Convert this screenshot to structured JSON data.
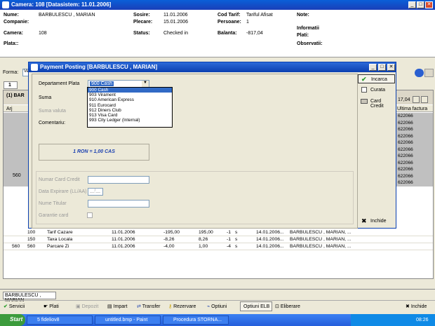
{
  "window": {
    "title": "Camera: 108  [Datasistem: 11.01.2006]",
    "btn_min": "_",
    "btn_max": "□",
    "btn_close": "✕"
  },
  "info": {
    "nume_label": "Nume:",
    "nume": "BARBULESCU , MARIAN",
    "companie_label": "Companie:",
    "camera_label": "Camera:",
    "camera": "108",
    "plata_label": "Plata::",
    "sosire_label": "Sosire:",
    "sosire": "11.01.2006",
    "plecare_label": "Plecare:",
    "plecare": "15.01.2006",
    "status_label": "Status:",
    "status": "Checked in",
    "cod_tarif_label": "Cod Tarif:",
    "cod_tarif": "Tariful Afisat",
    "persoane_label": "Persoane:",
    "persoane": "1",
    "balanta_label": "Balanta:",
    "balanta": "-817,04",
    "note_label": "Note:",
    "informatii_label": "Informatii",
    "plati_label": "Plati:",
    "observatii_label": "Observatii:"
  },
  "bg": {
    "forma_label": "Forma:",
    "forma_value": "Ve",
    "tab_1": "1",
    "group_header": "(1) BAR",
    "col_arj": "Arj",
    "ultima_factura_header": "Ultima factura",
    "balance_partial": "17,04",
    "ultima_values": [
      "622066",
      "622066",
      "622066",
      "622066",
      "622066",
      "622066",
      "622066",
      "622066",
      "622066",
      "622066",
      "622066"
    ],
    "left_560": "560"
  },
  "rows": [
    {
      "c1": "",
      "c2": "100",
      "desc": "Tarif Cazare",
      "date": "11.01.2006",
      "amount": "-195,00",
      "amount2": "195,00",
      "qty": "-1",
      "s": "s",
      "date2": "14.01.2006...",
      "guest": "BARBULESCU , MARIAN, ..."
    },
    {
      "c1": "",
      "c2": "150",
      "desc": "Taxa Locala",
      "date": "11.01.2006",
      "amount": "-8,26",
      "amount2": "8,26",
      "qty": "-1",
      "s": "s",
      "date2": "14.01.2006...",
      "guest": "BARBULESCU , MARIAN, ..."
    },
    {
      "c1": "560",
      "c2": "560",
      "desc": "Parcare Zi",
      "date": "11.01.2006",
      "amount": "-4,00",
      "amount2": "1,00",
      "qty": "-4",
      "s": "s",
      "date2": "14.01.2006...",
      "guest": "BARBULESCU , MARIAN, ..."
    }
  ],
  "status_tab": "BARBULESCU , MARIAN",
  "toolbar": {
    "servicii": "Servicii",
    "plati": "Plati",
    "depozit": "Depozit",
    "impart": "Impart",
    "transfer": "Transfer",
    "rezervare": "Rezervare",
    "optiuni": "Optiuni",
    "optiuni_elb": "Optiuni ELB",
    "eliberare": "Eliberare",
    "inchide": "Inchide"
  },
  "dialog": {
    "title": "Payment Posting  [BARBULESCU , MARIAN]",
    "dept_label": "Departament Plata",
    "dept_value": "900  Cash",
    "suma_label": "Suma",
    "suma_valuta_label": "Suma valuta",
    "comentariu_label": "Comentariu:",
    "rate_text": "1 RON = 1,00 CAS",
    "card_number_label": "Numar Card Credit",
    "card_expiry_label": "Data Expirare (LL/AA)",
    "card_expiry_placeholder": "__/__",
    "card_holder_label": "Nume Titular",
    "card_guarantee_label": "Garantie card",
    "options": [
      "900  Cash",
      "903  Virament",
      "910  American Express",
      "911  Eurocard",
      "912  Diners Club",
      "913  Visa Card",
      "993  City Ledger (Internal)"
    ],
    "btn_incarca": "Incarca",
    "btn_curata": "Curata",
    "btn_card_credit": "Card Credit",
    "btn_inchide": "Inchide"
  },
  "taskbar": {
    "start": "Start",
    "task1": "5 fideliov8",
    "task2": "untitled.bmp - Paint",
    "task3": "Procedura STORNA...",
    "clock": "08:26"
  },
  "colors": {
    "title_blue": "#0a5fd8",
    "grid_gray": "#c0c0c0",
    "rate_blue": "#1a3fb0"
  }
}
